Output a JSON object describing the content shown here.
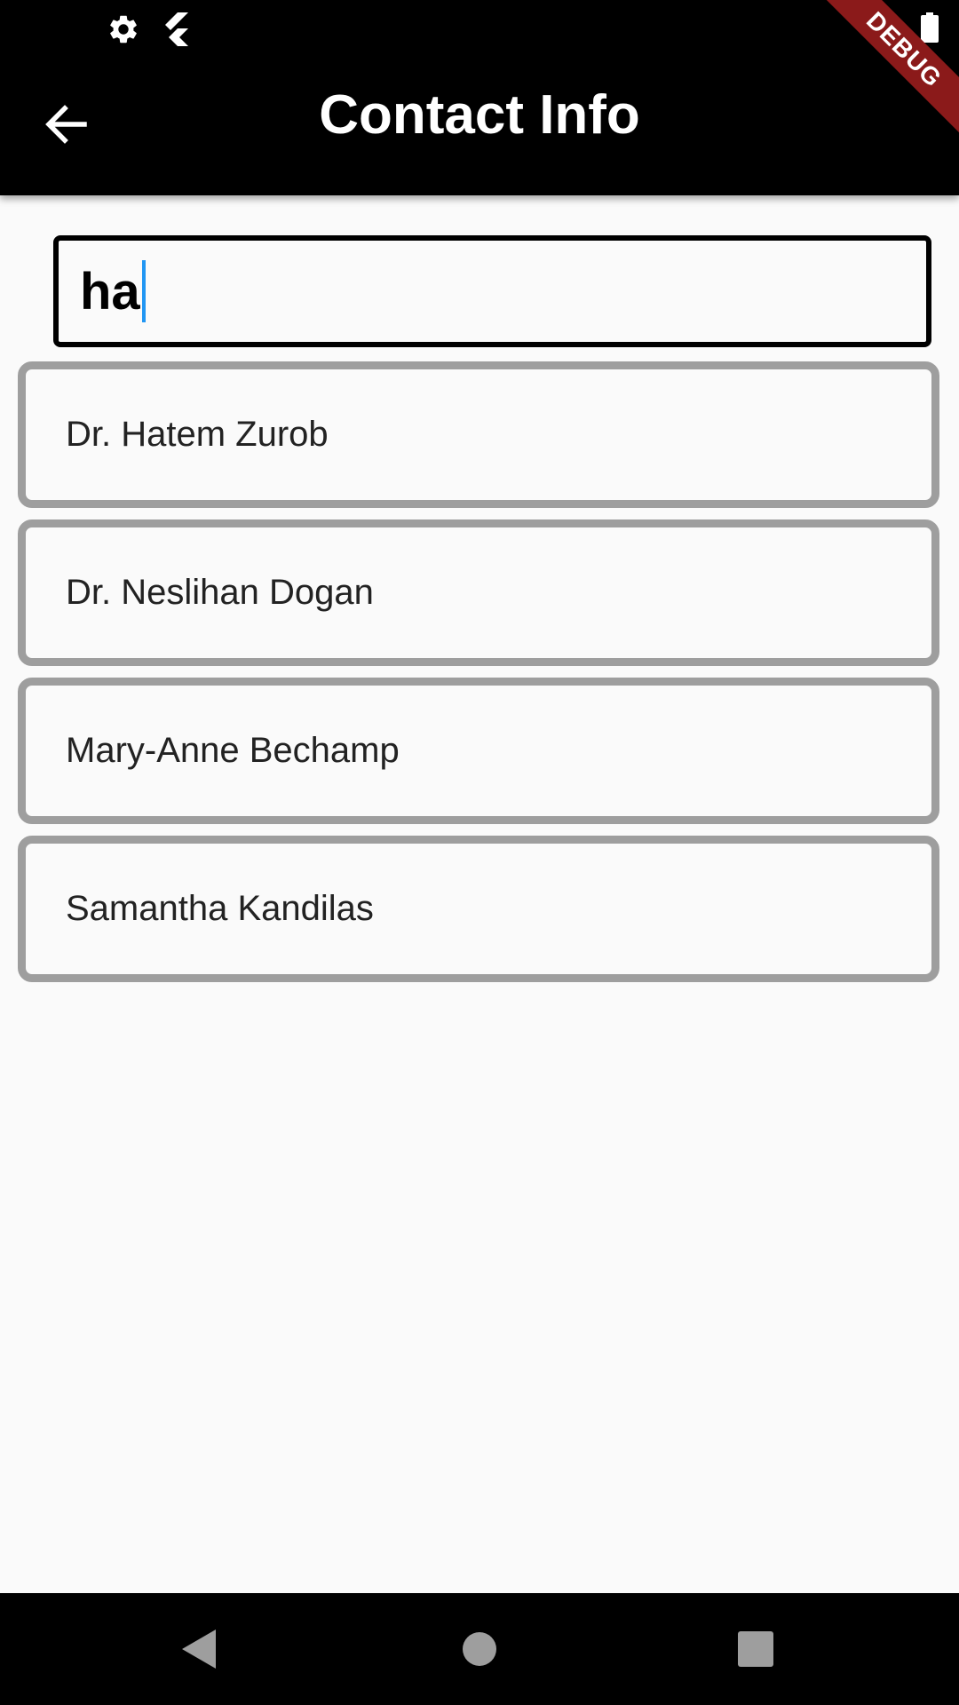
{
  "status_bar": {
    "icons": [
      "gear-icon",
      "flutter-icon",
      "battery-icon"
    ]
  },
  "app_bar": {
    "title": "Contact Info",
    "back_icon": "arrow-left-icon",
    "debug_banner": "DEBUG"
  },
  "search": {
    "value": "ha"
  },
  "contacts": [
    {
      "name": "Dr. Hatem Zurob"
    },
    {
      "name": "Dr. Neslihan Dogan"
    },
    {
      "name": "Mary-Anne Bechamp"
    },
    {
      "name": "Samantha Kandilas"
    }
  ],
  "nav_bar": {
    "icons": [
      "back-triangle-icon",
      "home-circle-icon",
      "recents-square-icon"
    ]
  },
  "colors": {
    "app_bar_bg": "#000000",
    "background": "#fafafa",
    "card_border": "#9e9e9e",
    "caret": "#2196f3",
    "debug_banner": "#8b1a1a"
  }
}
